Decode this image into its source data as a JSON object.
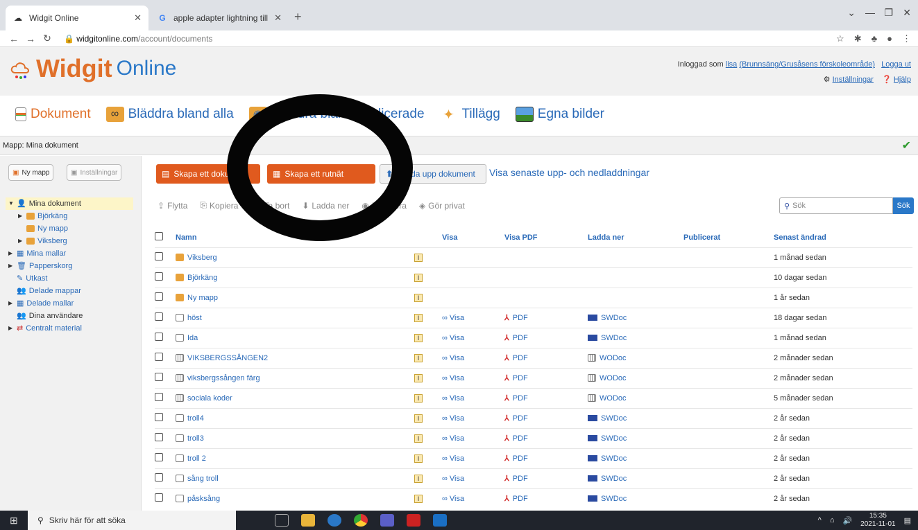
{
  "browser": {
    "tab_active": "Widgit Online",
    "tab_other": "apple adapter lightning till vga - ",
    "url_host": "widgitonline.com",
    "url_path": "/account/documents"
  },
  "header": {
    "logo_main": "Widgit",
    "logo_sub": "Online",
    "logged_in_prefix": "Inloggad som",
    "user": "lisa",
    "org": "(Brunnsäng/Grusåsens förskoleområde)",
    "logout": "Logga ut",
    "settings": "Inställningar",
    "help": "Hjälp"
  },
  "mainnav": {
    "items": [
      "Dokument",
      "Bläddra bland alla",
      "Bläddra bland publicerade",
      "Tillägg",
      "Egna bilder"
    ]
  },
  "breadcrumb": "Mapp: Mina dokument",
  "sidebar": {
    "new_folder": "Ny mapp",
    "settings": "Inställningar",
    "tree": [
      "Mina dokument",
      "Björkäng",
      "Ny mapp",
      "Viksberg",
      "Mina mallar",
      "Papperskorg",
      "Utkast",
      "Delade mappar",
      "Delade mallar",
      "Dina användare",
      "Centralt material"
    ]
  },
  "actions": {
    "create_doc": "Skapa ett dokument",
    "create_grid": "Skapa ett rutnät",
    "upload": "Ladda upp dokument",
    "recent": "Visa senaste upp- och nedladdningar"
  },
  "toolbar": [
    "Flytta",
    "Kopiera",
    "Ta bort",
    "Ladda ner",
    "Publicera",
    "Gör privat"
  ],
  "search": {
    "placeholder": "Sök",
    "button": "Sök"
  },
  "table": {
    "headers": [
      "Namn",
      "Visa",
      "Visa PDF",
      "Ladda ner",
      "Publicerat",
      "Senast ändrad"
    ],
    "rows": [
      {
        "name": "Viksberg",
        "type": "folder",
        "visa": "",
        "pdf": "",
        "dl": "",
        "date": "1 månad sedan"
      },
      {
        "name": "Björkäng",
        "type": "folder",
        "visa": "",
        "pdf": "",
        "dl": "",
        "date": "10 dagar sedan"
      },
      {
        "name": "Ny mapp",
        "type": "folder",
        "visa": "",
        "pdf": "",
        "dl": "",
        "date": "1 år sedan"
      },
      {
        "name": "höst",
        "type": "doc",
        "visa": "Visa",
        "pdf": "PDF",
        "dl": "SWDoc",
        "date": "18 dagar sedan"
      },
      {
        "name": "Ida",
        "type": "doc",
        "visa": "Visa",
        "pdf": "PDF",
        "dl": "SWDoc",
        "date": "1 månad sedan"
      },
      {
        "name": "VIKSBERGSSÅNGEN2",
        "type": "grid",
        "visa": "Visa",
        "pdf": "PDF",
        "dl": "WODoc",
        "date": "2 månader sedan"
      },
      {
        "name": "viksbergssången färg",
        "type": "grid",
        "visa": "Visa",
        "pdf": "PDF",
        "dl": "WODoc",
        "date": "2 månader sedan"
      },
      {
        "name": "sociala koder",
        "type": "grid",
        "visa": "Visa",
        "pdf": "PDF",
        "dl": "WODoc",
        "date": "5 månader sedan"
      },
      {
        "name": "troll4",
        "type": "doc",
        "visa": "Visa",
        "pdf": "PDF",
        "dl": "SWDoc",
        "date": "2 år sedan"
      },
      {
        "name": "troll3",
        "type": "doc",
        "visa": "Visa",
        "pdf": "PDF",
        "dl": "SWDoc",
        "date": "2 år sedan"
      },
      {
        "name": "troll 2",
        "type": "doc",
        "visa": "Visa",
        "pdf": "PDF",
        "dl": "SWDoc",
        "date": "2 år sedan"
      },
      {
        "name": "sång troll",
        "type": "doc",
        "visa": "Visa",
        "pdf": "PDF",
        "dl": "SWDoc",
        "date": "2 år sedan"
      },
      {
        "name": "påsksång",
        "type": "doc",
        "visa": "Visa",
        "pdf": "PDF",
        "dl": "SWDoc",
        "date": "2 år sedan"
      }
    ]
  },
  "taskbar": {
    "search": "Skriv här för att söka",
    "time": "15:35",
    "date": "2021-11-01"
  }
}
